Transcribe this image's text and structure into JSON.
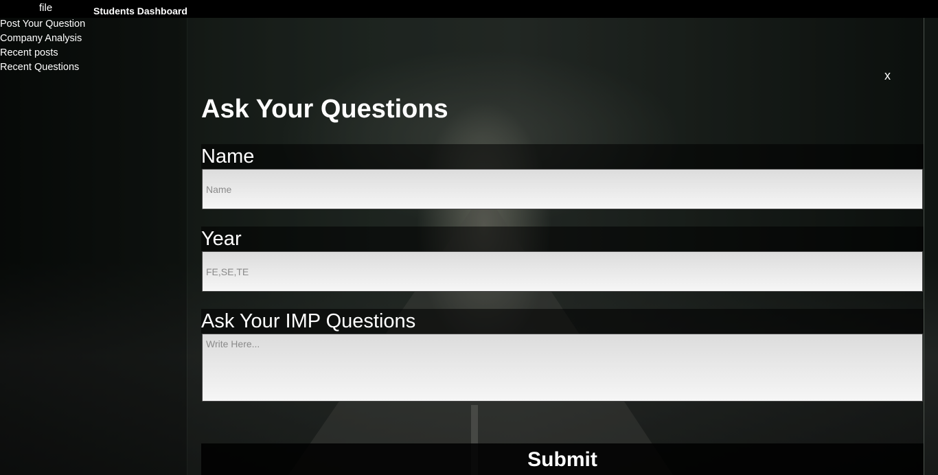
{
  "header": {
    "brand": "file",
    "title": "Students Dashboard"
  },
  "sidebar": {
    "items": [
      {
        "label": "Post Your Question"
      },
      {
        "label": "Company Analysis"
      },
      {
        "label": "Recent posts"
      },
      {
        "label": "Recent Questions"
      }
    ]
  },
  "modal": {
    "close_label": "x",
    "title": "Ask Your Questions",
    "fields": {
      "name": {
        "label": "Name",
        "placeholder": "Name",
        "value": ""
      },
      "year": {
        "label": "Year",
        "placeholder": "FE,SE,TE",
        "value": ""
      },
      "question": {
        "label": "Ask Your IMP Questions",
        "placeholder": "Write Here...",
        "value": ""
      }
    },
    "submit_label": "Submit"
  }
}
